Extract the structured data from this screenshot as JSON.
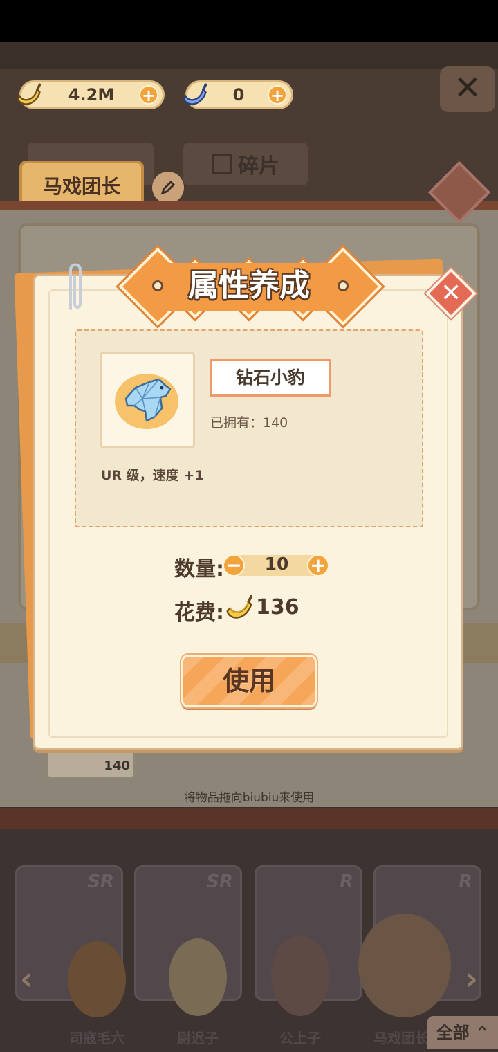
{
  "colors": {
    "accent": "#f29a44",
    "modal_bg": "#fcf3df",
    "close_red": "#e36b56",
    "coin_gold": "#f2c84b",
    "blue_banana": "#5b86e0"
  },
  "header": {
    "banana_amount": "4.2M",
    "blue_banana_amount": "0",
    "banana_icon": "banana-icon",
    "blue_banana_icon": "blue-banana-icon",
    "plus_icon": "plus-icon"
  },
  "background": {
    "tabs": {
      "fragments": "碎片",
      "circus_leader": "马戏团长"
    },
    "item_count": "140",
    "drag_hint": "将物品拖向biubiu来使用",
    "characters": [
      {
        "name": "司寇毛六",
        "rank": "SR"
      },
      {
        "name": "尉迟子",
        "rank": "SR"
      },
      {
        "name": "公上子",
        "rank": "R"
      },
      {
        "name": "马戏团长",
        "rank": "R"
      }
    ],
    "all_button": "全部"
  },
  "modal": {
    "title": "属性养成",
    "item_name": "钻石小豹",
    "owned_text": "已拥有：140",
    "description": "UR 级，速度 +1",
    "quantity_label": "数量:",
    "quantity": "10",
    "cost_label": "花费:",
    "cost": "136",
    "use_button": "使用"
  }
}
